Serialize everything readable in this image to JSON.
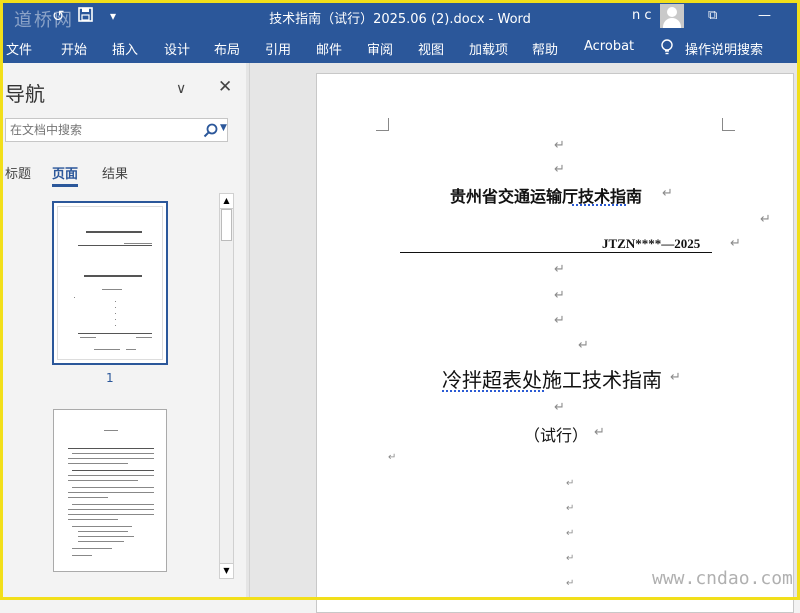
{
  "titlebar": {
    "watermark": "道桥网",
    "undo_icon": "↺",
    "save_icon": "💾",
    "customize_icon": "▾",
    "document_title": "技术指南（试行）2025.06 (2).docx  -  Word",
    "user_initials": "n c",
    "ribbon_options_icon": "⧉",
    "minimize_icon": "—"
  },
  "ribbon": {
    "tabs": [
      "文件",
      "开始",
      "插入",
      "设计",
      "布局",
      "引用",
      "邮件",
      "审阅",
      "视图",
      "加载项",
      "帮助",
      "Acrobat"
    ],
    "tell_me": "操作说明搜索"
  },
  "nav": {
    "title": "导航",
    "menu_icon": "∨",
    "close_icon": "✕",
    "search_placeholder": "在文档中搜索",
    "search_dropdown_icon": "▼",
    "tabs": [
      "标题",
      "页面",
      "结果"
    ],
    "active_tab": "页面",
    "page_label": "1",
    "scroll_up": "▲",
    "scroll_down": "▼"
  },
  "document": {
    "paragraph_mark": "↵",
    "organization": "贵州省交通运输厅技术指南",
    "code": "JTZN****—2025",
    "title": "冷拌超表处施工技术指南",
    "subtitle": "（试行）"
  },
  "watermark_bottom": "www.cndao.com",
  "colors": {
    "accent": "#2b579a",
    "frame": "#f2df1a",
    "squiggle": "#2b5bd4"
  }
}
